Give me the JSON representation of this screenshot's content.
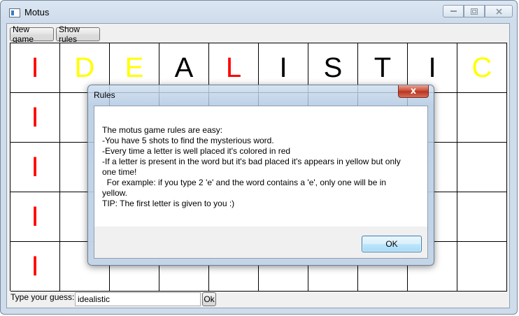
{
  "window": {
    "title": "Motus"
  },
  "toolbar": {
    "new_game_label": "New game",
    "show_rules_label": "Show rules"
  },
  "colors": {
    "correct": "#ff0000",
    "misplaced": "#ffff00",
    "normal": "#000000"
  },
  "board": {
    "rows": [
      [
        {
          "letter": "I",
          "state": "correct"
        },
        {
          "letter": "D",
          "state": "misplaced"
        },
        {
          "letter": "E",
          "state": "misplaced"
        },
        {
          "letter": "A",
          "state": "normal"
        },
        {
          "letter": "L",
          "state": "correct"
        },
        {
          "letter": "I",
          "state": "normal"
        },
        {
          "letter": "S",
          "state": "normal"
        },
        {
          "letter": "T",
          "state": "normal"
        },
        {
          "letter": "I",
          "state": "normal"
        },
        {
          "letter": "C",
          "state": "misplaced"
        }
      ],
      [
        {
          "letter": "I",
          "state": "correct"
        },
        {
          "letter": "",
          "state": "normal"
        },
        {
          "letter": "",
          "state": "normal"
        },
        {
          "letter": "",
          "state": "normal"
        },
        {
          "letter": "",
          "state": "normal"
        },
        {
          "letter": "",
          "state": "normal"
        },
        {
          "letter": "",
          "state": "normal"
        },
        {
          "letter": "",
          "state": "normal"
        },
        {
          "letter": "",
          "state": "normal"
        },
        {
          "letter": "",
          "state": "normal"
        }
      ],
      [
        {
          "letter": "I",
          "state": "correct"
        },
        {
          "letter": "",
          "state": "normal"
        },
        {
          "letter": "",
          "state": "normal"
        },
        {
          "letter": "",
          "state": "normal"
        },
        {
          "letter": "",
          "state": "normal"
        },
        {
          "letter": "",
          "state": "normal"
        },
        {
          "letter": "",
          "state": "normal"
        },
        {
          "letter": "",
          "state": "normal"
        },
        {
          "letter": "",
          "state": "normal"
        },
        {
          "letter": "",
          "state": "normal"
        }
      ],
      [
        {
          "letter": "I",
          "state": "correct"
        },
        {
          "letter": "",
          "state": "normal"
        },
        {
          "letter": "",
          "state": "normal"
        },
        {
          "letter": "",
          "state": "normal"
        },
        {
          "letter": "",
          "state": "normal"
        },
        {
          "letter": "",
          "state": "normal"
        },
        {
          "letter": "",
          "state": "normal"
        },
        {
          "letter": "",
          "state": "normal"
        },
        {
          "letter": "",
          "state": "normal"
        },
        {
          "letter": "",
          "state": "normal"
        }
      ],
      [
        {
          "letter": "I",
          "state": "correct"
        },
        {
          "letter": "",
          "state": "normal"
        },
        {
          "letter": "",
          "state": "normal"
        },
        {
          "letter": "",
          "state": "normal"
        },
        {
          "letter": "",
          "state": "normal"
        },
        {
          "letter": "",
          "state": "normal"
        },
        {
          "letter": "",
          "state": "normal"
        },
        {
          "letter": "",
          "state": "normal"
        },
        {
          "letter": "",
          "state": "normal"
        },
        {
          "letter": "",
          "state": "normal"
        }
      ]
    ]
  },
  "guess": {
    "label": "Type your guess:",
    "value": "idealistic",
    "ok_label": "Ok"
  },
  "dialog": {
    "title": "Rules",
    "close_glyph": "x",
    "lines": [
      "The motus game rules are easy:",
      "-You have 5 shots to find the mysterious word.",
      "-Every time a letter is well placed it's colored in red",
      "-If a letter is present in the word but it's bad placed it's appears in yellow but only",
      "one time!",
      "  For example: if you type 2 'e' and the word contains a 'e', only one will be in",
      "yellow.",
      "TIP: The first letter is given to you :)"
    ],
    "ok_label": "OK"
  }
}
